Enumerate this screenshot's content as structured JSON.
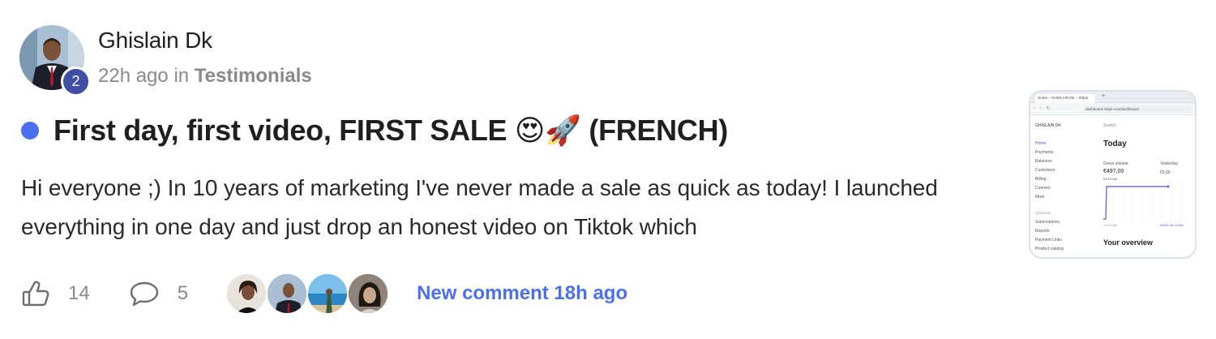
{
  "author": {
    "name": "Ghislain Dk",
    "level": "2"
  },
  "meta": {
    "time": "22h ago",
    "in_text": "in",
    "category": "Testimonials"
  },
  "post": {
    "title": "First day, first video, FIRST SALE 😍🚀 (FRENCH)",
    "body": "Hi everyone ;) In 10 years of marketing I've never made a sale as quick as today! I launched everything in one day and just drop an honest video on Tiktok which"
  },
  "actions": {
    "likes": "14",
    "comments": "5",
    "new_comment": "New comment 18h ago"
  },
  "thumbnail": {
    "tab_title": "Home – GHISLAIN DK – Stripe",
    "tab_plus": "+",
    "url": "dashboard.stripe.com/dashboard",
    "brand": "GHISLAIN DK",
    "nav_items": [
      "Home",
      "Payments",
      "Balances",
      "Customers",
      "Billing",
      "Connect",
      "More"
    ],
    "section_label": "Shortcuts",
    "shortcut_items": [
      "Subscriptions",
      "Reports",
      "Payment Links",
      "Product catalog"
    ],
    "search": "Search",
    "today": "Today",
    "gross_volume_label": "Gross volume",
    "gross_volume": "€497,00",
    "gross_volume_time": "03:19 AM",
    "yesterday_label": "Yesterday",
    "yesterday_value": "€0,00",
    "x_start": "12:00 AM",
    "x_end": "NOW, 03:19 AM",
    "overview": "Your overview",
    "accent": "#5a4fe0"
  },
  "colors": {
    "accent_blue": "#4a6ff0",
    "badge": "#3f4fa6",
    "muted": "#8a8a8a"
  }
}
